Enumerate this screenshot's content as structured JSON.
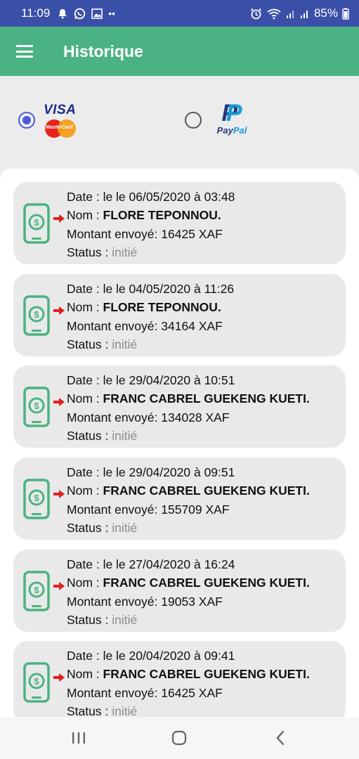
{
  "status_bar": {
    "time": "11:09",
    "battery": "85%",
    "left_icons": [
      "notification-icon",
      "whatsapp-icon",
      "gallery-icon",
      "more-dots-icon"
    ],
    "right_icons": [
      "alarm-icon",
      "wifi-icon",
      "signal-icon",
      "signal-icon",
      "battery-icon"
    ]
  },
  "app_bar": {
    "title": "Historique",
    "menu_icon": "hamburger-menu-icon",
    "background": "#4bb383"
  },
  "payment_methods": {
    "selected": "visa",
    "visa": {
      "logo_text": "VISA",
      "sub_logo_text": "MasterCard"
    },
    "paypal": {
      "logo_text_pay": "Pay",
      "logo_text_pal": "Pal"
    }
  },
  "labels": {
    "date_prefix": "Date : ",
    "name_prefix": "Nom : ",
    "amount_prefix": "Montant envoyé: ",
    "status_prefix": "Status : "
  },
  "transactions": [
    {
      "date": "le le 06/05/2020 à 03:48",
      "name": "FLORE TEPONNOU.",
      "amount": "16425 XAF",
      "status": "initié"
    },
    {
      "date": "le le 04/05/2020 à 11:26",
      "name": "FLORE TEPONNOU.",
      "amount": "34164 XAF",
      "status": "initié"
    },
    {
      "date": "le le 29/04/2020 à 10:51",
      "name": "FRANC CABREL GUEKENG KUETI.",
      "amount": "134028 XAF",
      "status": "initié"
    },
    {
      "date": "le le 29/04/2020 à 09:51",
      "name": "FRANC CABREL GUEKENG KUETI.",
      "amount": "155709 XAF",
      "status": "initié"
    },
    {
      "date": "le le 27/04/2020 à 16:24",
      "name": "FRANC CABREL GUEKENG KUETI.",
      "amount": "19053 XAF",
      "status": "initié"
    },
    {
      "date": "le le 20/04/2020 à 09:41",
      "name": "FRANC CABREL GUEKENG KUETI.",
      "amount": "16425 XAF",
      "status": "initié"
    }
  ],
  "nav_bar": {
    "buttons": [
      "recent-apps-icon",
      "home-icon",
      "back-icon"
    ]
  }
}
